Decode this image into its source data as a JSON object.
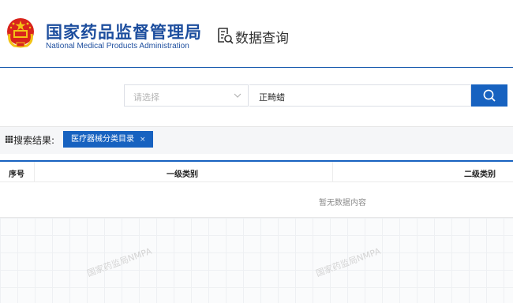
{
  "header": {
    "brand_cn": "国家药品监督管理局",
    "brand_en": "National Medical Products Administration",
    "section_title": "数据查询"
  },
  "search": {
    "select_placeholder": "请选择",
    "keyword_value": "正畸蜡"
  },
  "results": {
    "label": "搜索结果:",
    "active_tag": "医疗器械分类目录",
    "tag_close": "×"
  },
  "table": {
    "columns": [
      "序号",
      "一级类别",
      "二级类别"
    ],
    "empty_text": "暂无数据内容"
  },
  "watermark": "国家药监局NMPA",
  "colors": {
    "brand_blue": "#1d4e9e",
    "accent_blue": "#1762c0",
    "emblem_red": "#d9241c",
    "emblem_gold": "#f3c316"
  },
  "icons": {
    "emblem": "national-emblem-icon",
    "data_query": "document-search-icon",
    "dropdown": "chevron-down-icon",
    "search": "search-icon",
    "result": "grid-icon"
  }
}
